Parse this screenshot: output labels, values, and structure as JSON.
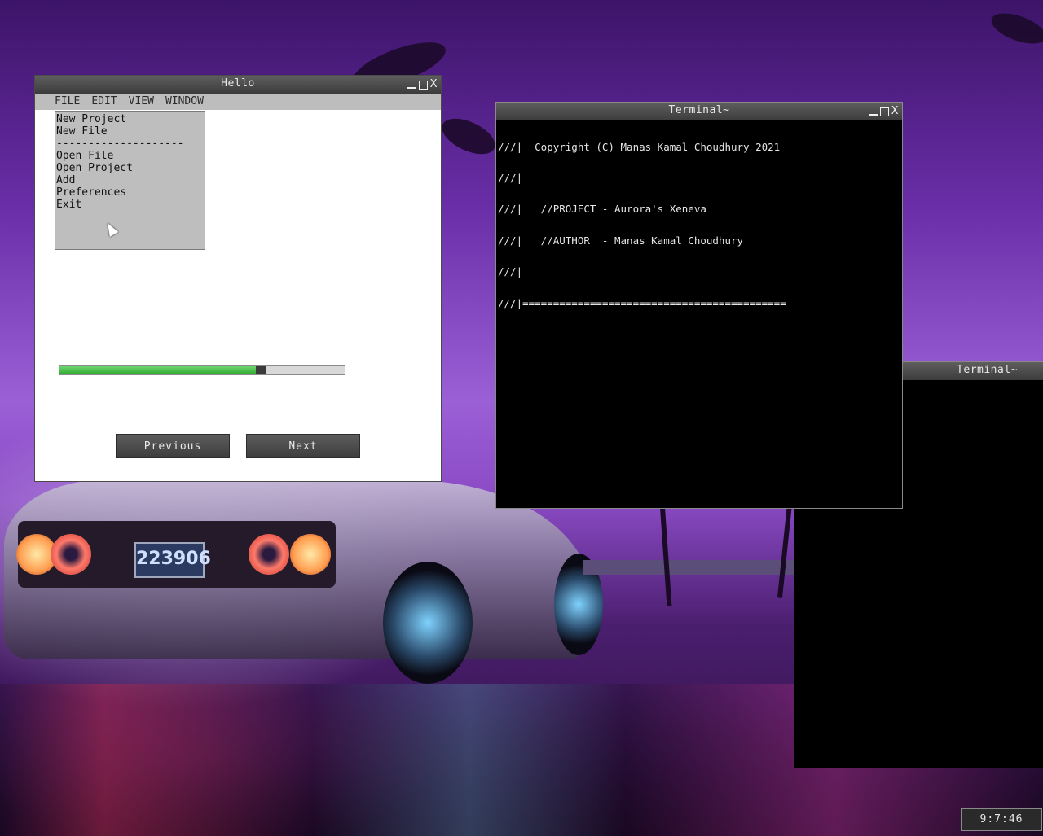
{
  "hello_window": {
    "title": "Hello",
    "controls": {
      "minimize": "_",
      "maximize": "□",
      "close": "X"
    },
    "menu": [
      "FILE",
      "EDIT",
      "VIEW",
      "WINDOW"
    ],
    "file_menu_items": [
      "New Project",
      "New File",
      "--------------------",
      "Open File",
      "Open Project",
      "Add",
      "Preferences",
      "Exit"
    ],
    "progress_fraction": 0.69,
    "buttons": {
      "previous": "Previous",
      "next": "Next"
    }
  },
  "terminal_main": {
    "title": "Terminal~",
    "controls": {
      "close": "X"
    },
    "lines": [
      "///|  Copyright (C) Manas Kamal Choudhury 2021",
      "///|",
      "///|   //PROJECT - Aurora's Xeneva",
      "///|   //AUTHOR  - Manas Kamal Choudhury",
      "///|",
      "///|===========================================_"
    ]
  },
  "terminal_back": {
    "title": "Terminal~"
  },
  "taskbar": {
    "clock": "9:7:46"
  },
  "colors": {
    "titlebar": "#4a4a4a",
    "menubar": "#bdbdbd",
    "progress_fill": "#3cb83c",
    "terminal_bg": "#000000"
  }
}
